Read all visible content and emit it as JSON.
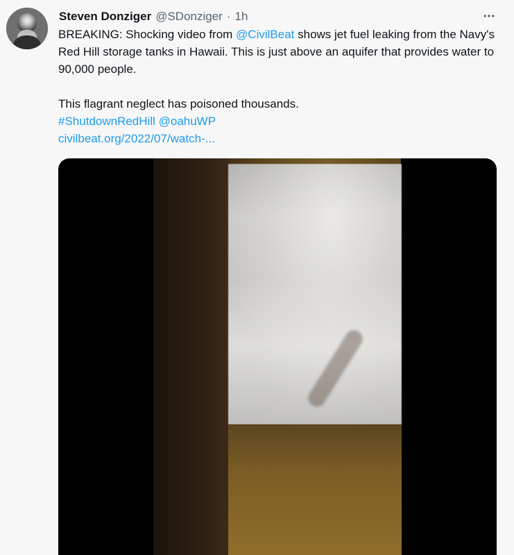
{
  "author": {
    "display_name": "Steven Donziger",
    "handle": "@SDonziger",
    "separator": "·",
    "time": "1h"
  },
  "tweet": {
    "line1_part1": "BREAKING: Shocking video from ",
    "mention_civilbeat": "@CivilBeat",
    "line1_part2": " shows jet fuel leaking from the Navy's Red Hill storage tanks in Hawaii. This is just above an aquifer that provides water to 90,000 people.",
    "line2": "This flagrant neglect has poisoned thousands.",
    "hashtag": "#ShutdownRedHill",
    "mention_oahuwp": "@oahuWP",
    "url": "civilbeat.org/2022/07/watch-..."
  },
  "icons": {
    "more": "more-icon",
    "avatar": "avatar"
  },
  "colors": {
    "link": "#1d9bf0",
    "text": "#0f1419",
    "muted": "#536471",
    "background": "#f7f7f7"
  }
}
